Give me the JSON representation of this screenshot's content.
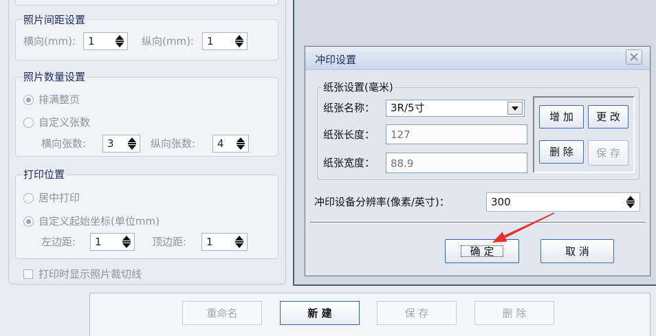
{
  "colors": {
    "title": "#1c2b5e",
    "disabled": "#8e939b",
    "accent": "#3a6bb3",
    "annotation": "#e5322d"
  },
  "icons": {
    "close": "close-icon",
    "spinner": "spin-arrows-icon",
    "dropdown": "dropdown-arrow-icon",
    "annotation": "red-arrow-icon"
  },
  "left_panel": {
    "spacing": {
      "title": "照片间距设置",
      "horizontal": {
        "label": "横向(mm):",
        "value": "1"
      },
      "vertical": {
        "label": "纵向(mm):",
        "value": "1"
      }
    },
    "count": {
      "title": "照片数量设置",
      "fill_page": {
        "label": "排满整页",
        "checked": true
      },
      "custom_count": {
        "label": "自定义张数",
        "checked": false
      },
      "horizontal": {
        "label": "横向张数:",
        "value": "3"
      },
      "vertical": {
        "label": "纵向张数:",
        "value": "4"
      }
    },
    "position": {
      "title": "打印位置",
      "center": {
        "label": "居中打印",
        "checked": false
      },
      "custom_origin": {
        "label": "自定义起始坐标(单位mm)",
        "checked": true
      },
      "left_margin": {
        "label": "左边距:",
        "value": "1"
      },
      "top_margin": {
        "label": "顶边距:",
        "value": "1"
      }
    },
    "show_cut_lines": {
      "label": "打印时显示照片裁切线",
      "checked": false
    }
  },
  "dialog": {
    "title": "冲印设置",
    "paper": {
      "title": "纸张设置(毫米)",
      "name": {
        "label": "纸张名称：",
        "value": "3R/5寸"
      },
      "length": {
        "label": "纸张长度：",
        "value": "127"
      },
      "width": {
        "label": "纸张宽度：",
        "value": "88.9"
      },
      "buttons": {
        "add": {
          "label": "增 加",
          "disabled": false
        },
        "modify": {
          "label": "更 改",
          "disabled": false
        },
        "delete": {
          "label": "删 除",
          "disabled": false
        },
        "save": {
          "label": "保 存",
          "disabled": true
        }
      }
    },
    "resolution": {
      "label": "冲印设备分辨率(像素/英寸)：",
      "value": "300"
    },
    "ok": {
      "label": "确 定",
      "focused": true
    },
    "cancel": {
      "label": "取 消"
    }
  },
  "toolbar": {
    "rename": {
      "label": "重命名",
      "disabled": true
    },
    "new": {
      "label": "新 建",
      "active": true
    },
    "save": {
      "label": "保 存",
      "disabled": true
    },
    "delete": {
      "label": "删 除",
      "disabled": true
    }
  }
}
